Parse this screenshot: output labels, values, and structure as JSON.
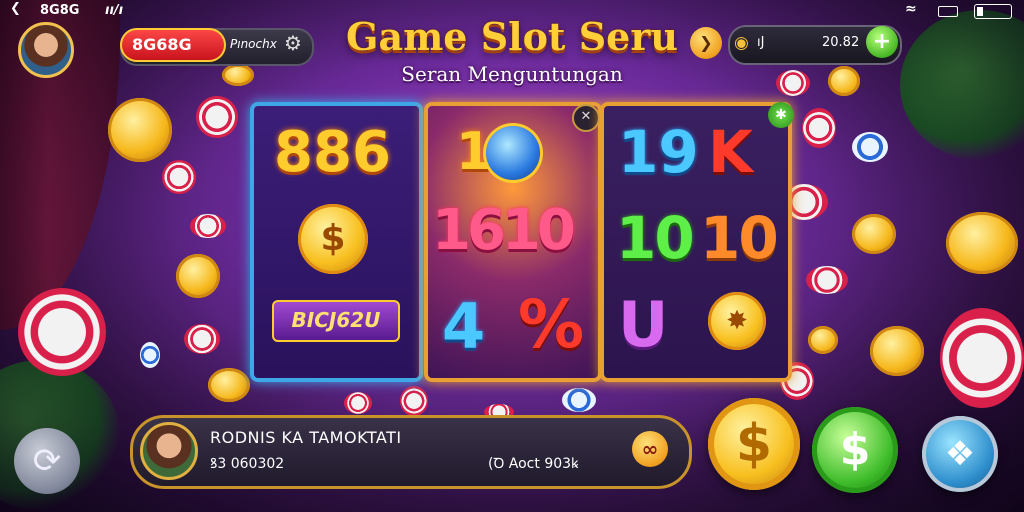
{
  "status_bar": {
    "back_icon": "chevron-left-icon",
    "carrier": "8G8G",
    "clock": "ıı/ı",
    "wifi_icon": "wifi-icon",
    "signal_icon": "signal-icon",
    "battery_icon": "battery-icon"
  },
  "header": {
    "brand": "8G68G",
    "brand_sub": "Pınochx",
    "settings_icon": "gear-icon",
    "title": "Game Slot Seru",
    "subtitle": "Seran Menguntungan",
    "arrow_icon": "arrow-right-icon",
    "balance_icon": "coin-stack-icon",
    "balance_label": "ıJ",
    "balance_value": "20.82",
    "add_icon": "plus-icon"
  },
  "reels": {
    "reel1": {
      "top": "886",
      "middle_icon": "dollar-sun-icon",
      "bottom": "BICJ62U"
    },
    "reel2": {
      "top": "10",
      "top_icon": "globe-bow-icon",
      "middle": "1610",
      "bottom_a": "4",
      "bottom_b": "%",
      "close_icon": "close-icon"
    },
    "reel3": {
      "top_a": "19",
      "top_b": "K",
      "middle_a": "10",
      "middle_b": "10",
      "bottom_a": "U",
      "bottom_icon": "gold-wheel-icon",
      "star_icon": "star-icon"
    }
  },
  "bottom": {
    "refresh_icon": "refresh-icon",
    "player_name": "RODNIS KA TAMOKTATI",
    "player_left": "ꝸ3 060302",
    "player_right": "(Ꝺ Aoct 903ꝃ",
    "panel_button_icon": "ribbon-icon",
    "coin_symbol": "$",
    "green_symbol": "$",
    "blue_icon": "stack-icon"
  },
  "colors": {
    "gold": "#ffcc2e",
    "reel_blue": "#3fa7e6",
    "reel_orange": "#e8a035",
    "green": "#3ebc2a"
  }
}
